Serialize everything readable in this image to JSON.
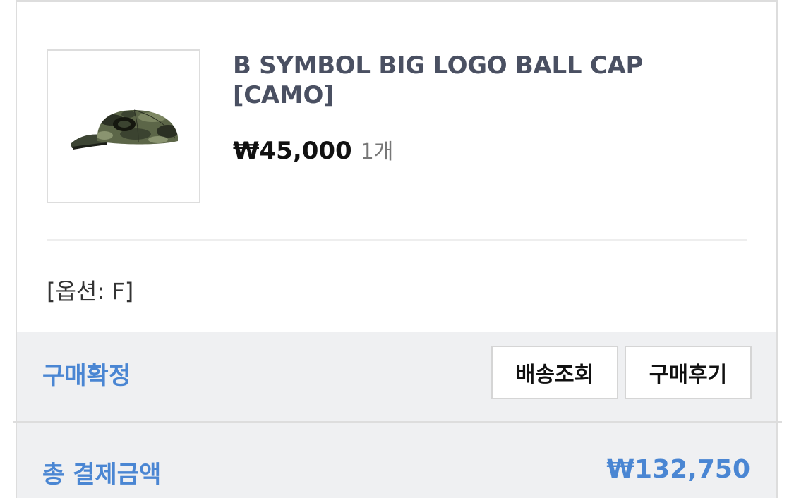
{
  "order_item": {
    "product_name": "B SYMBOL BIG LOGO BALL CAP [CAMO]",
    "price": "₩45,000",
    "quantity": "1개",
    "option": "[옵션: F]",
    "image_icon": "camo-ball-cap-icon"
  },
  "actions": {
    "status": "구매확정",
    "delivery_button": "배송조회",
    "review_button": "구매후기"
  },
  "summary": {
    "total_label": "총 결제금액",
    "total_amount": "₩132,750"
  },
  "colors": {
    "accent": "#4a86d3",
    "product_name": "#4a5062",
    "panel_bg": "#eff0f2",
    "border": "#dddddd"
  }
}
